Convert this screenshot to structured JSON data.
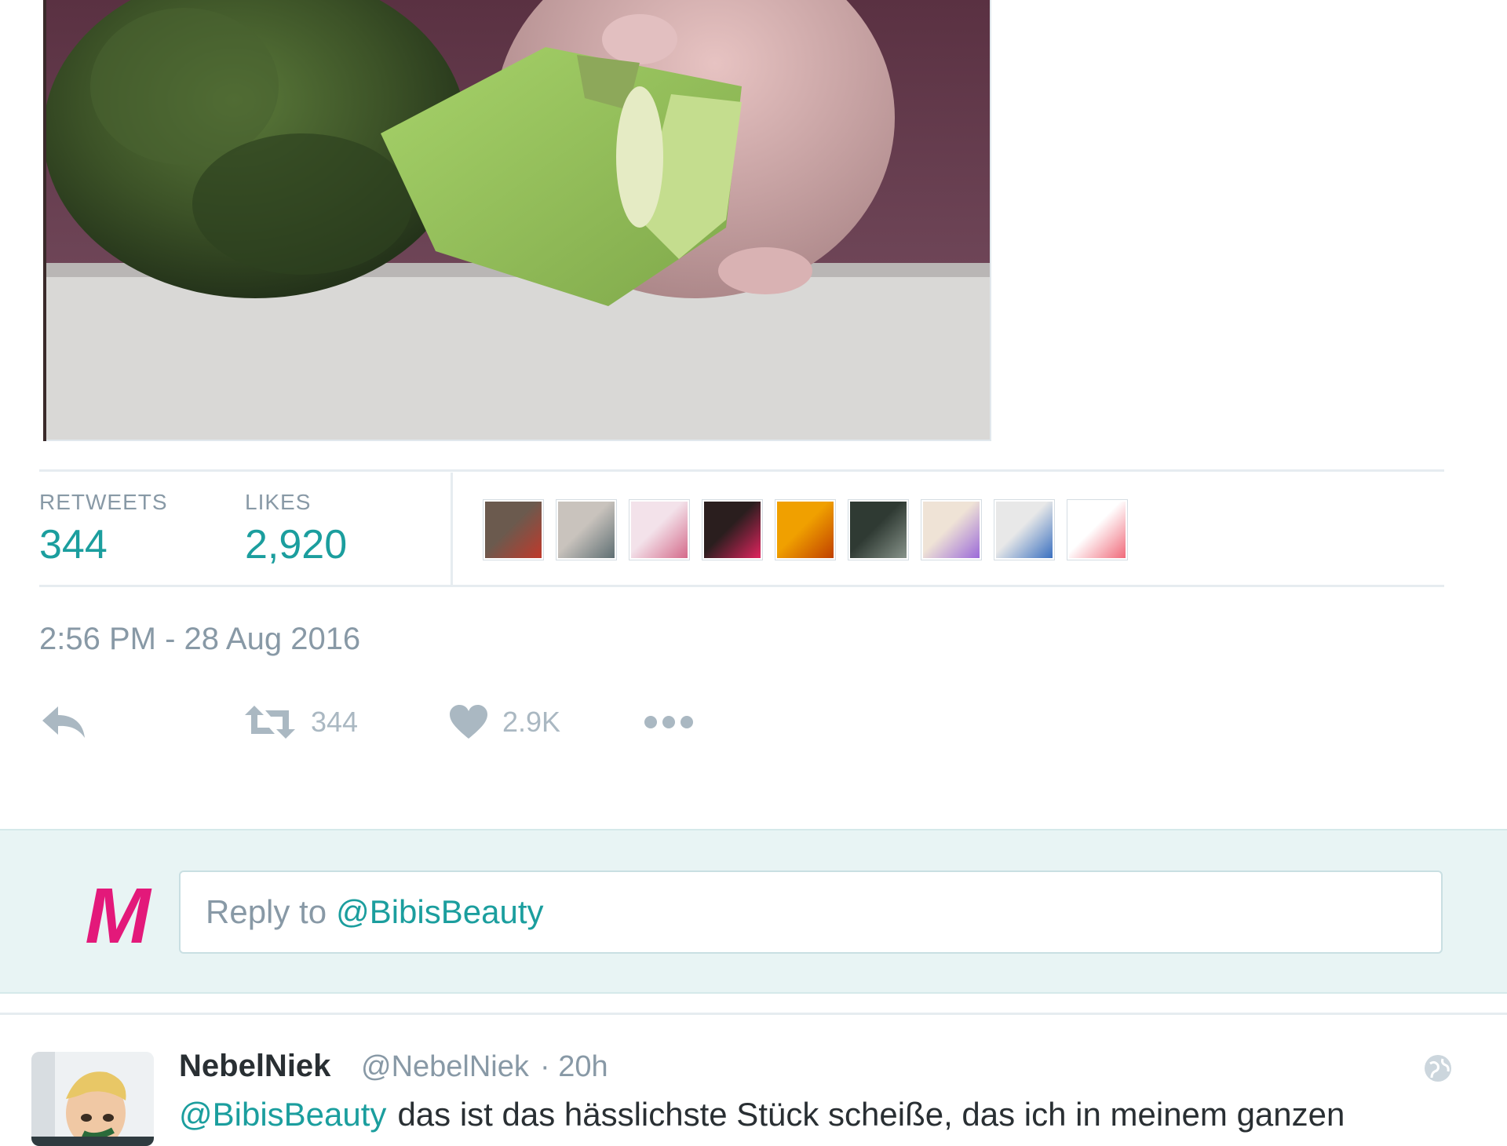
{
  "tweet": {
    "stats": {
      "retweets_label": "RETWEETS",
      "retweets_value": "344",
      "likes_label": "LIKES",
      "likes_value": "2,920"
    },
    "likers": [
      {
        "color_a": "#6b5a4e",
        "color_b": "#c0392b"
      },
      {
        "color_a": "#c9c3bd",
        "color_b": "#5f6f73"
      },
      {
        "color_a": "#f3e2ea",
        "color_b": "#d46a8a"
      },
      {
        "color_a": "#2a1e1e",
        "color_b": "#e0245e"
      },
      {
        "color_a": "#f0a000",
        "color_b": "#c04000"
      },
      {
        "color_a": "#2f3a33",
        "color_b": "#87938a"
      },
      {
        "color_a": "#efe3d6",
        "color_b": "#9b6ad9"
      },
      {
        "color_a": "#e8e8e8",
        "color_b": "#3a70c0"
      },
      {
        "color_a": "#ffffff",
        "color_b": "#f06a7a"
      }
    ],
    "timestamp": "2:56 PM - 28 Aug 2016",
    "actions": {
      "reply_icon": "reply-arrow-icon",
      "retweet_count": "344",
      "like_count": "2.9K",
      "more_icon": "ellipsis-icon"
    }
  },
  "reply_box": {
    "logo_letter": "M",
    "logo_color": "#e3197a",
    "prefix": "Reply to",
    "mention": "@BibisBeauty"
  },
  "reply_tweet": {
    "name": "NebelNiek",
    "handle": "@NebelNiek",
    "time": "· 20h",
    "mention": "@BibisBeauty",
    "text": "das ist das hässlichste Stück scheiße, das ich in meinem ganzen"
  },
  "colors": {
    "accent": "#1b9e9e",
    "muted": "#8899a6",
    "text": "#292f33"
  }
}
